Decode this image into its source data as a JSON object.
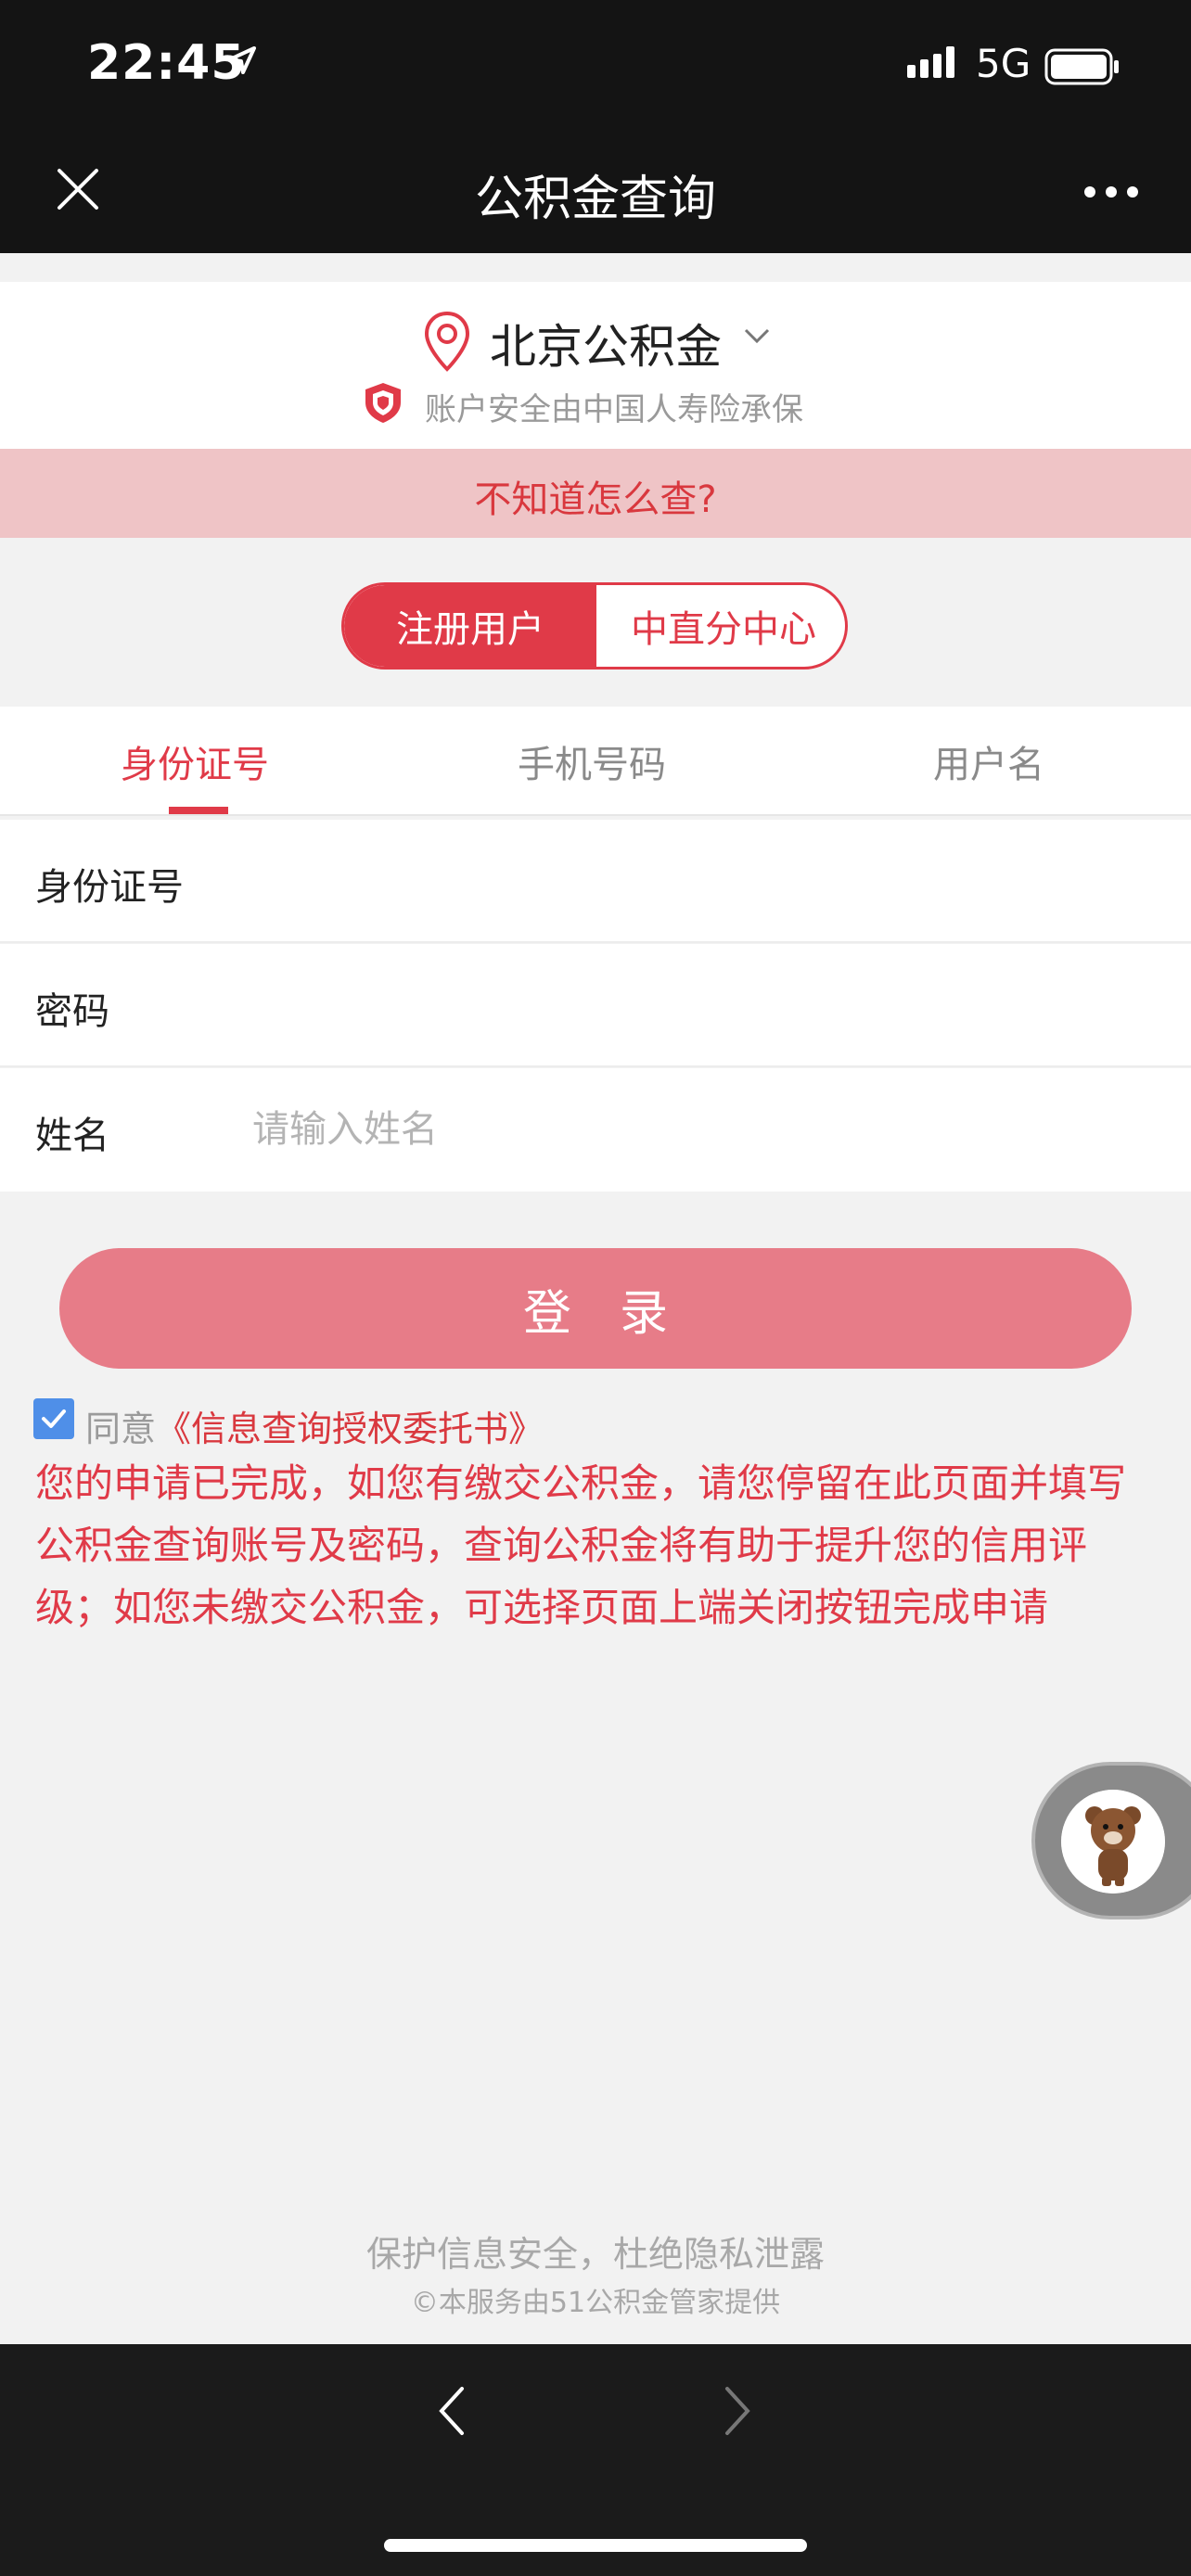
{
  "status": {
    "time": "22:45",
    "network": "5G"
  },
  "nav": {
    "title": "公积金查询"
  },
  "city": {
    "name": "北京公积金",
    "insurance_note": "账户安全由中国人寿险承保"
  },
  "help": {
    "text": "不知道怎么查?"
  },
  "segment": {
    "options": [
      "注册用户",
      "中直分中心"
    ],
    "selected": "注册用户"
  },
  "tabs": [
    {
      "label": "身份证号",
      "active": true
    },
    {
      "label": "手机号码",
      "active": false
    },
    {
      "label": "用户名",
      "active": false
    }
  ],
  "form": {
    "id_label": "身份证号",
    "id_value": "",
    "id_placeholder": "",
    "password_label": "密码",
    "password_value": "",
    "password_placeholder": "",
    "name_label": "姓名",
    "name_value": "",
    "name_placeholder": "请输入姓名"
  },
  "login": {
    "label": "登录"
  },
  "agree": {
    "checked": true,
    "prefix": "同意",
    "link": "《信息查询授权委托书》"
  },
  "notice": "您的申请已完成，如您有缴交公积金，请您停留在此页面并填写公积金查询账号及密码，查询公积金将有助于提升您的信用评级；如您未缴交公积金，可选择页面上端关闭按钮完成申请",
  "footer": {
    "line1": "保护信息安全，杜绝隐私泄露",
    "line2": "©本服务由51公积金管家提供"
  },
  "colors": {
    "accent": "#e03a48",
    "dark_bar": "#141414",
    "banner": "#efc4c6",
    "login_bg": "#e77c88",
    "checkbox": "#4f8fe8"
  },
  "icons": [
    "location-arrow-icon",
    "signal-icon",
    "battery-icon",
    "close-icon",
    "more-icon",
    "location-pin-icon",
    "chevron-down-icon",
    "shield-icon",
    "checkbox-checked-icon",
    "back-arrow-icon",
    "forward-arrow-icon",
    "bear-avatar-icon"
  ]
}
